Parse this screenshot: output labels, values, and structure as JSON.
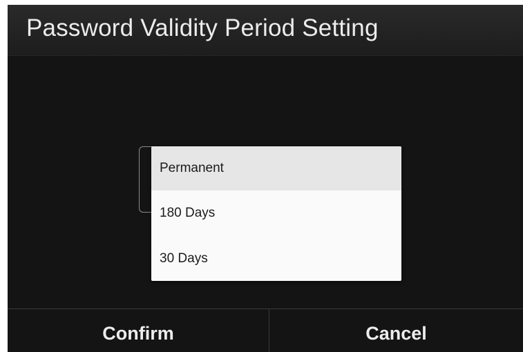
{
  "dialog": {
    "title": "Password Validity Period Setting"
  },
  "dropdown": {
    "selected": "Permanent",
    "options": [
      {
        "label": "Permanent",
        "selected": true
      },
      {
        "label": "180 Days",
        "selected": false
      },
      {
        "label": "30 Days",
        "selected": false
      }
    ]
  },
  "buttons": {
    "confirm_label": "Confirm",
    "cancel_label": "Cancel"
  },
  "colors": {
    "dialog_background": "#141414",
    "title_bar": "#242424",
    "menu_background": "#fafafa",
    "selected_option": "#e6e6e6",
    "text_light": "#ececec"
  }
}
